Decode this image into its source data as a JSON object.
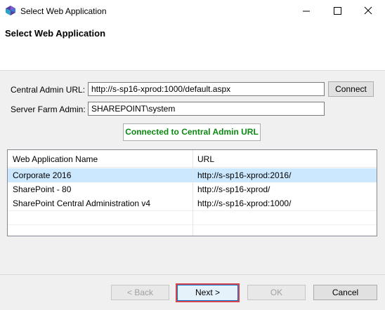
{
  "window": {
    "title": "Select Web Application"
  },
  "header": {
    "title": "Select Web Application"
  },
  "form": {
    "central_admin_label": "Central Admin URL:",
    "central_admin_value": "http://s-sp16-xprod:1000/default.aspx",
    "connect_label": "Connect",
    "farm_admin_label": "Server Farm Admin:",
    "farm_admin_value": "SHAREPOINT\\system",
    "status_text": "Connected to Central Admin URL"
  },
  "table": {
    "columns": [
      "Web Application Name",
      "URL"
    ],
    "rows": [
      {
        "name": "Corporate 2016",
        "url": "http://s-sp16-xprod:2016/",
        "selected": true
      },
      {
        "name": "SharePoint - 80",
        "url": "http://s-sp16-xprod/",
        "selected": false
      },
      {
        "name": "SharePoint Central Administration v4",
        "url": "http://s-sp16-xprod:1000/",
        "selected": false
      }
    ]
  },
  "footer": {
    "back_label": "< Back",
    "next_label": "Next >",
    "ok_label": "OK",
    "cancel_label": "Cancel"
  },
  "colors": {
    "status_text": "#0b8a12",
    "selection": "#cce8ff",
    "focus_outline": "#d9434b"
  }
}
